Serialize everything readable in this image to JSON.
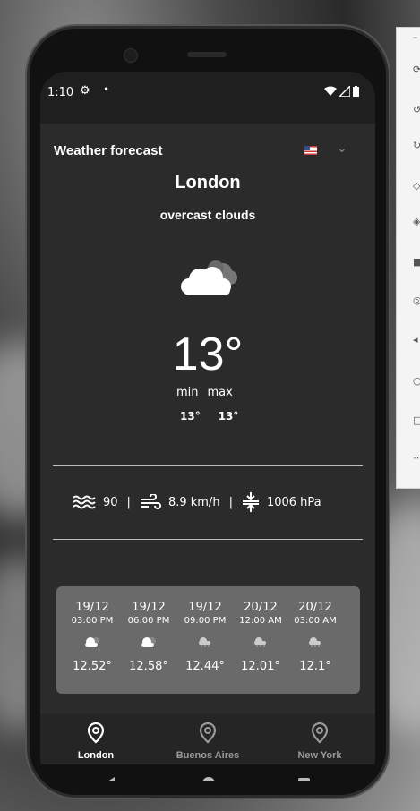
{
  "status_bar": {
    "time": "1:10",
    "gear_icon": "gear-icon",
    "dot": "•"
  },
  "header": {
    "title": "Weather forecast",
    "flag_icon": "us-flag-icon",
    "chevron_icon": "chevron-down-icon"
  },
  "current": {
    "city": "London",
    "description": "overcast clouds",
    "temperature": "13°",
    "min_label": "min",
    "max_label": "max",
    "min_value": "13°",
    "max_value": "13°"
  },
  "metrics": {
    "humidity": "90",
    "sep": "|",
    "wind": "8.9 km/h",
    "pressure": "1006 hPa"
  },
  "forecast": [
    {
      "date": "19/12",
      "time": "03:00 PM",
      "temp": "12.52°"
    },
    {
      "date": "19/12",
      "time": "06:00 PM",
      "temp": "12.58°"
    },
    {
      "date": "19/12",
      "time": "09:00 PM",
      "temp": "12.44°"
    },
    {
      "date": "20/12",
      "time": "12:00 AM",
      "temp": "12.01°"
    },
    {
      "date": "20/12",
      "time": "03:00 AM",
      "temp": "12.1°"
    }
  ],
  "bottom_nav": [
    {
      "label": "London",
      "active": true
    },
    {
      "label": "Buenos Aires",
      "active": false
    },
    {
      "label": "New York",
      "active": false
    }
  ],
  "colors": {
    "accent_active": "#ffffff",
    "inactive": "#9a9a9a",
    "card": "#6a6a6a"
  }
}
